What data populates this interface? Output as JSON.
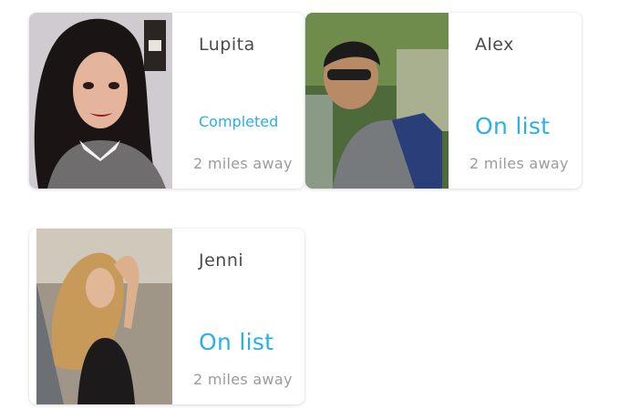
{
  "cards": [
    {
      "name": "Lupita",
      "status": "Completed",
      "distance": "2 miles away",
      "photo": "portrait-woman-dark-hair"
    },
    {
      "name": "Alex",
      "status": "On list",
      "distance": "2 miles away",
      "photo": "portrait-man-sunglasses-outdoors"
    },
    {
      "name": "Jenni",
      "status": "On list",
      "distance": "2 miles away",
      "photo": "portrait-woman-blonde-waterside"
    }
  ],
  "colors": {
    "accent": "#29b0e5",
    "name": "#4a4a4a",
    "muted": "#9b9b9b"
  }
}
